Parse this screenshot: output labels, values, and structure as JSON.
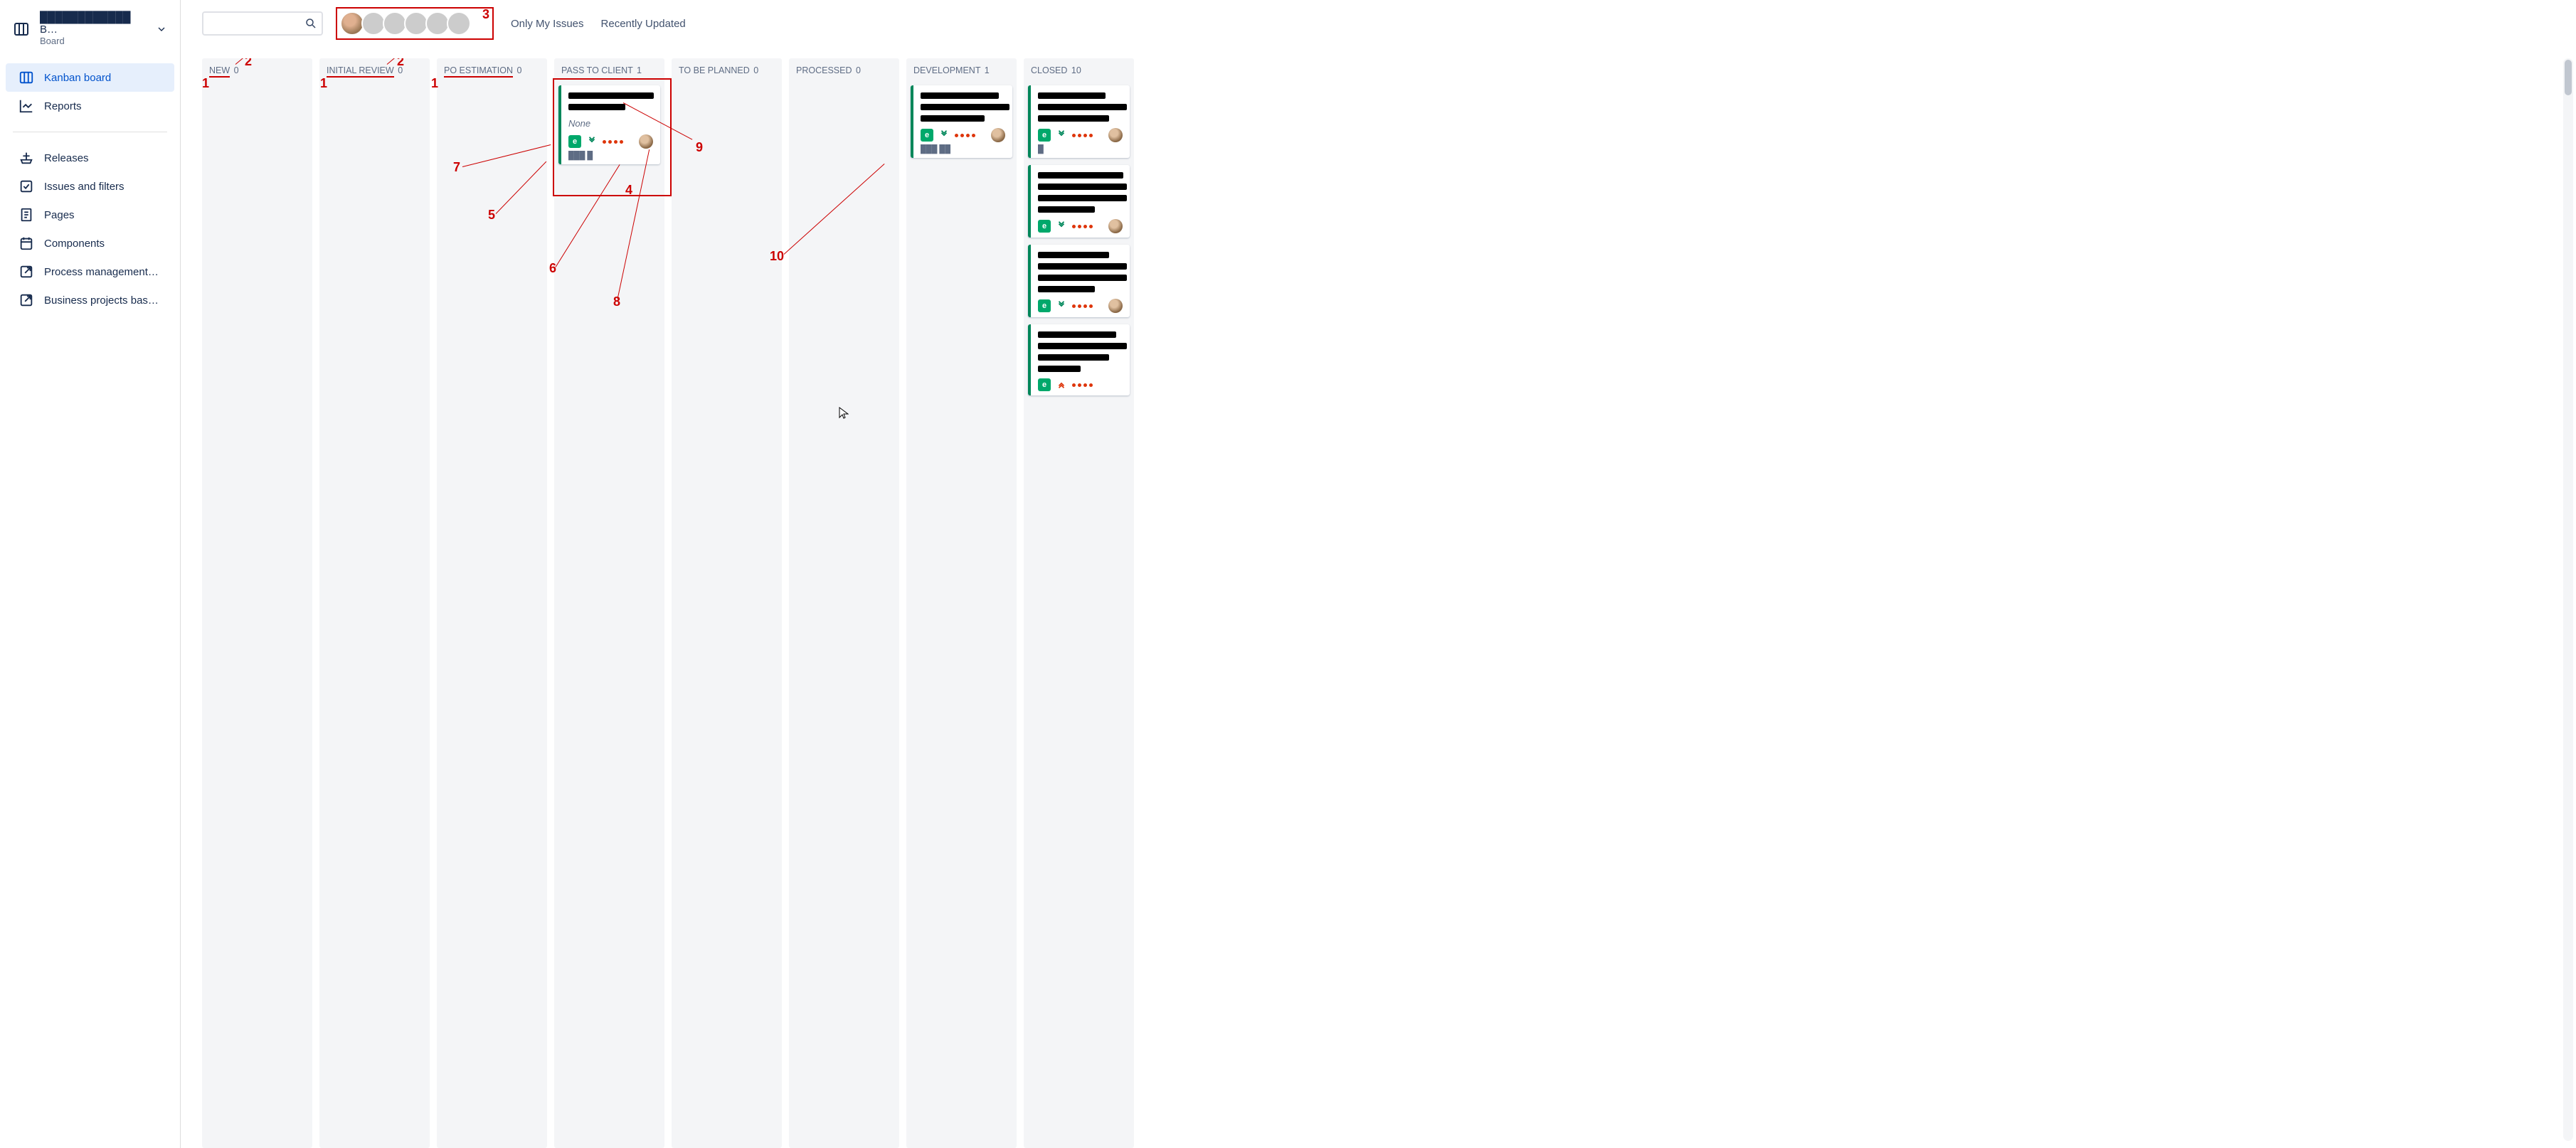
{
  "sidebar": {
    "top_title": "████████████ B…",
    "top_sub": "Board",
    "items": [
      {
        "label": "Kanban board",
        "name": "kanban-board",
        "active": true,
        "icon": "board-icon"
      },
      {
        "label": "Reports",
        "name": "reports",
        "icon": "reports-icon"
      }
    ],
    "items2": [
      {
        "label": "Releases",
        "name": "releases",
        "icon": "ship-icon"
      },
      {
        "label": "Issues and filters",
        "name": "issues-filters",
        "icon": "check-square-icon"
      },
      {
        "label": "Pages",
        "name": "pages",
        "icon": "page-icon"
      },
      {
        "label": "Components",
        "name": "components",
        "icon": "calendar-icon"
      },
      {
        "label": "Process management…",
        "name": "process-mgmt",
        "icon": "external-icon"
      },
      {
        "label": "Business projects bas…",
        "name": "business-projects",
        "icon": "external-icon"
      }
    ]
  },
  "topbar": {
    "search_placeholder": "",
    "only_my": "Only My Issues",
    "recently": "Recently Updated"
  },
  "columns": [
    {
      "title": "NEW",
      "count": "0",
      "underline": true
    },
    {
      "title": "INITIAL REVIEW",
      "count": "0",
      "underline": true
    },
    {
      "title": "PO ESTIMATION",
      "count": "0",
      "underline": true
    },
    {
      "title": "PASS TO CLIENT",
      "count": "1"
    },
    {
      "title": "TO BE PLANNED",
      "count": "0"
    },
    {
      "title": "PROCESSED",
      "count": "0"
    },
    {
      "title": "DEVELOPMENT",
      "count": "1"
    },
    {
      "title": "CLOSED",
      "count": "10"
    }
  ],
  "card_pass": {
    "sub": "None",
    "key": "███ █"
  },
  "card_dev": {
    "key": "███ ██"
  },
  "anns": {
    "a1": "1",
    "a2": "2",
    "a3": "3",
    "a4": "4",
    "a5": "5",
    "a6": "6",
    "a7": "7",
    "a8": "8",
    "a9": "9",
    "a10": "10"
  }
}
